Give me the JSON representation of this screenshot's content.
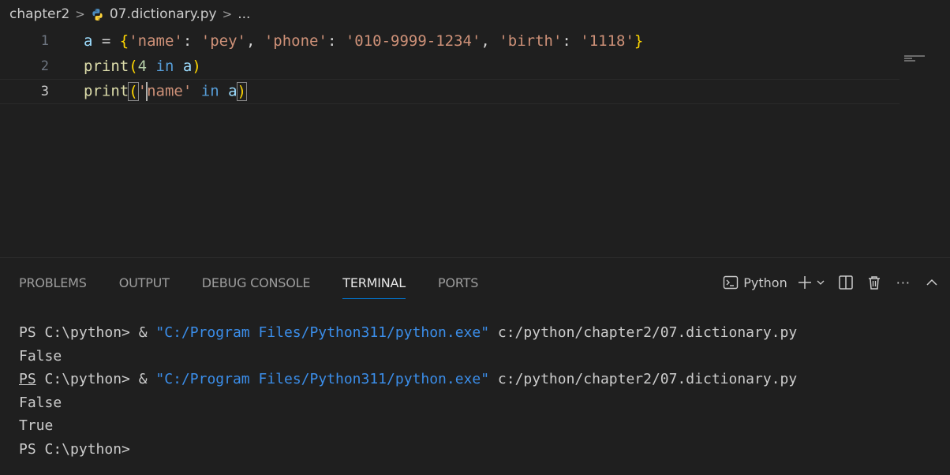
{
  "breadcrumb": {
    "folder": "chapter2",
    "file": "07.dictionary.py",
    "more": "...",
    "separator": ">"
  },
  "editor": {
    "lines": [
      {
        "number": "1",
        "text": "a = {'name': 'pey', 'phone': '010-9999-1234', 'birth': '1118'}"
      },
      {
        "number": "2",
        "text": "print(4 in a)"
      },
      {
        "number": "3",
        "text": "print('name' in a)"
      }
    ],
    "active_line": "3",
    "tokens": {
      "l1": {
        "var": "a",
        "eq": " = ",
        "ob": "{",
        "k1": "'name'",
        "c1": ": ",
        "v1": "'pey'",
        "s1": ", ",
        "k2": "'phone'",
        "c2": ": ",
        "v2": "'010-9999-1234'",
        "s2": ", ",
        "k3": "'birth'",
        "c3": ": ",
        "v3": "'1118'",
        "cb": "}"
      },
      "l2": {
        "fn": "print",
        "op": "(",
        "num": "4",
        "kw": " in ",
        "var": "a",
        "cp": ")"
      },
      "l3": {
        "fn": "print",
        "op": "(",
        "q": "'",
        "str": "name'",
        "kw": " in ",
        "var": "a",
        "cp": ")"
      }
    }
  },
  "panel": {
    "tabs": [
      "PROBLEMS",
      "OUTPUT",
      "DEBUG CONSOLE",
      "TERMINAL",
      "PORTS"
    ],
    "active_tab": "TERMINAL",
    "terminal_name": "Python",
    "more": "···"
  },
  "terminal": {
    "prompt": "PS C:\\python>",
    "prompt_ps": "PS",
    "prompt_rest": " C:\\python>",
    "amp": " & ",
    "exe": "\"C:/Program Files/Python311/python.exe\"",
    "script": " c:/python/chapter2/07.dictionary.py",
    "output_1": [
      "False"
    ],
    "output_2": [
      "False",
      "True"
    ]
  },
  "icons": [
    "python-file-icon",
    "terminal-icon",
    "plus-icon",
    "chevron-down-icon",
    "split-icon",
    "trash-icon",
    "more-icon",
    "chevron-up-icon"
  ],
  "colors": {
    "accent": "#0078d4",
    "string": "#ce9178",
    "function": "#dcdcaa",
    "keyword": "#569cd6",
    "terminal_string": "#3b8eea"
  }
}
